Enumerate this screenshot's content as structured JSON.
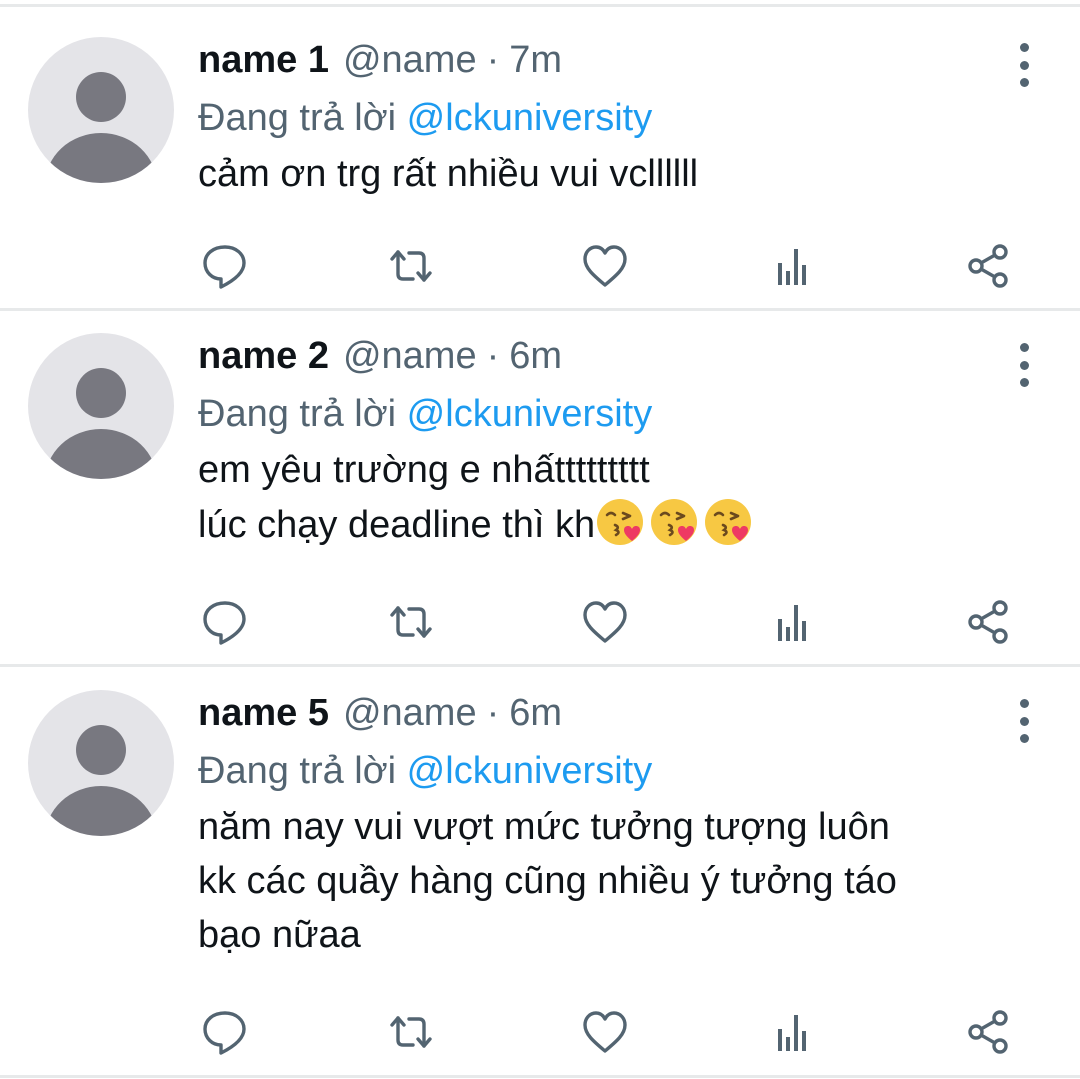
{
  "reply_label": "Đang trả lời",
  "mention": "@lckuniversity",
  "tweets": [
    {
      "name": "name 1",
      "handle": "@name",
      "separator": "·",
      "time": "7m",
      "body_lines": [
        "cảm ơn trg rất nhiều vui vcllllll"
      ],
      "emoji_count": 0
    },
    {
      "name": "name 2",
      "handle": "@name",
      "separator": "·",
      "time": "6m",
      "body_lines": [
        "em yêu trường e nhấttttttttt",
        "lúc chạy deadline thì kh"
      ],
      "emoji_count": 3,
      "emoji": "face-blowing-a-kiss"
    },
    {
      "name": "name 5",
      "handle": "@name",
      "separator": "·",
      "time": "6m",
      "body_lines": [
        "năm nay vui vượt mức tưởng tượng luôn",
        "kk các quầy hàng cũng nhiều ý tưởng táo",
        "bạo nữaa"
      ],
      "emoji_count": 0
    }
  ],
  "icons": {
    "avatar": "default-profile-avatar",
    "more": "more-vertical-icon",
    "reply": "reply-icon",
    "retweet": "retweet-icon",
    "like": "heart-icon",
    "views": "analytics-icon",
    "share": "share-icon"
  },
  "colors": {
    "text": "#0f1419",
    "secondary": "#536471",
    "accent": "#1d9bf0",
    "divider": "#e7e9ea",
    "avatar_bg": "#e4e4e8",
    "avatar_fg": "#787880"
  }
}
